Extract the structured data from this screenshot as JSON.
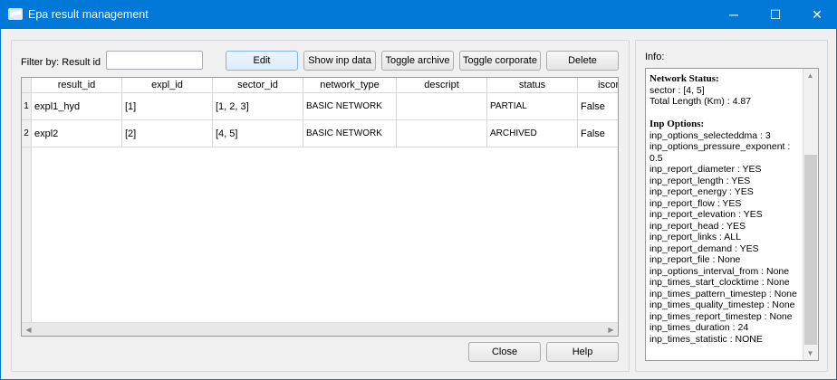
{
  "window": {
    "title": "Epa result management",
    "controls": {
      "minimize": "─",
      "maximize": "☐",
      "close": "✕"
    }
  },
  "filter": {
    "label": "Filter by: Result id",
    "value": "",
    "placeholder": ""
  },
  "toolbar": {
    "edit": "Edit",
    "show_inp": "Show inp data",
    "toggle_archive": "Toggle archive",
    "toggle_corporate": "Toggle corporate",
    "delete": "Delete"
  },
  "table": {
    "columns": [
      "result_id",
      "expl_id",
      "sector_id",
      "network_type",
      "descript",
      "status",
      "iscor"
    ],
    "rows": [
      {
        "num": "1",
        "cells": [
          "expl1_hyd",
          "[1]",
          "[1, 2, 3]",
          "BASIC NETWORK",
          "",
          "PARTIAL",
          "False"
        ]
      },
      {
        "num": "2",
        "cells": [
          "expl2",
          "[2]",
          "[4, 5]",
          "BASIC NETWORK",
          "",
          "ARCHIVED",
          "False"
        ]
      }
    ]
  },
  "footer": {
    "close": "Close",
    "help": "Help"
  },
  "info": {
    "label": "Info:",
    "network_heading": "Network Status:",
    "network_lines": [
      "sector : [4, 5]",
      "Total Length (Km) : 4.87"
    ],
    "inp_heading": "Inp Options:",
    "inp_lines": [
      "inp_options_selecteddma : 3",
      "inp_options_pressure_exponent : 0.5",
      "inp_report_diameter : YES",
      "inp_report_length : YES",
      "inp_report_energy : YES",
      "inp_report_flow : YES",
      "inp_report_elevation : YES",
      "inp_report_head : YES",
      "inp_report_links : ALL",
      "inp_report_demand : YES",
      "inp_report_file : None",
      "inp_options_interval_from : None",
      "inp_times_start_clocktime : None",
      "inp_times_pattern_timestep : None",
      "inp_times_quality_timestep : None",
      "inp_times_report_timestep : None",
      "inp_times_duration : 24",
      "inp_times_statistic : NONE"
    ]
  },
  "colors": {
    "titlebar": "#0078d7",
    "background": "#f0f0f0"
  }
}
